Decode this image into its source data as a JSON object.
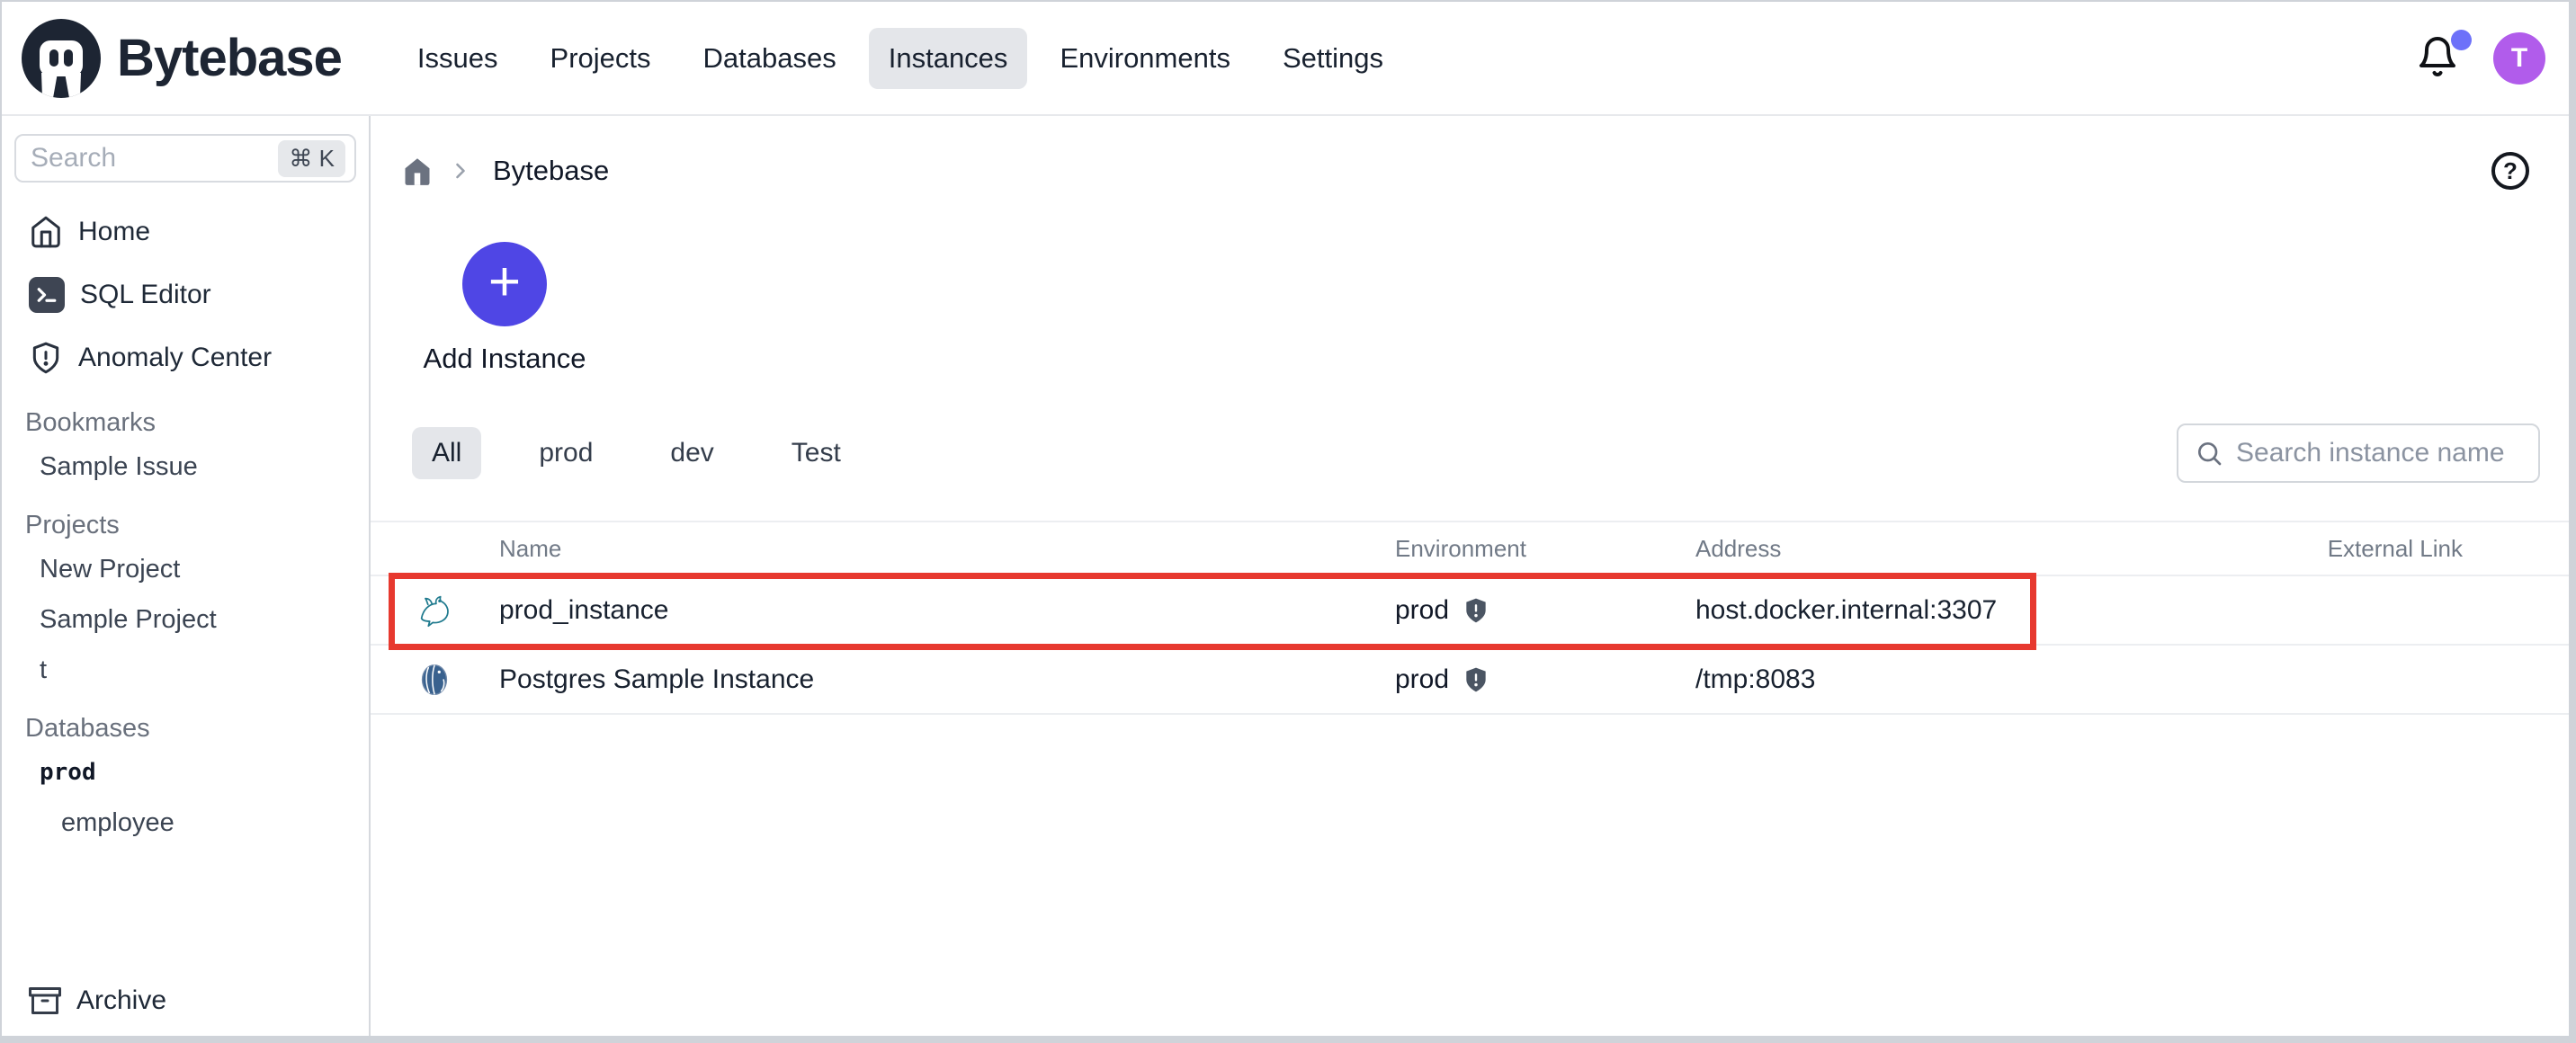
{
  "header": {
    "brand": "Bytebase",
    "nav": [
      {
        "label": "Issues",
        "active": false
      },
      {
        "label": "Projects",
        "active": false
      },
      {
        "label": "Databases",
        "active": false
      },
      {
        "label": "Instances",
        "active": true
      },
      {
        "label": "Environments",
        "active": false
      },
      {
        "label": "Settings",
        "active": false
      }
    ],
    "notifications": {
      "has_unread": true
    },
    "avatar_initial": "T"
  },
  "sidebar": {
    "search": {
      "placeholder": "Search",
      "shortcut": "⌘ K"
    },
    "nav_items": [
      {
        "label": "Home",
        "icon": "home-icon"
      },
      {
        "label": "SQL Editor",
        "icon": "terminal-icon"
      },
      {
        "label": "Anomaly Center",
        "icon": "shield-alert-icon"
      }
    ],
    "sections": [
      {
        "title": "Bookmarks",
        "items": [
          "Sample Issue"
        ]
      },
      {
        "title": "Projects",
        "items": [
          "New Project",
          "Sample Project",
          "t"
        ]
      },
      {
        "title": "Databases",
        "items": [
          "prod",
          "employee"
        ]
      }
    ],
    "archive_label": "Archive"
  },
  "main": {
    "breadcrumb": {
      "current": "Bytebase"
    },
    "add_instance_label": "Add Instance",
    "plus_glyph": "+",
    "help_glyph": "?",
    "filters": [
      {
        "label": "All",
        "active": true
      },
      {
        "label": "prod",
        "active": false
      },
      {
        "label": "dev",
        "active": false
      },
      {
        "label": "Test",
        "active": false
      }
    ],
    "search_placeholder": "Search instance name",
    "table": {
      "columns": [
        "Name",
        "Environment",
        "Address",
        "External Link"
      ],
      "rows": [
        {
          "name": "prod_instance",
          "engine": "mysql",
          "environment": "prod",
          "address": "host.docker.internal:3307",
          "external_link": "",
          "highlighted": true
        },
        {
          "name": "Postgres Sample Instance",
          "engine": "postgres",
          "environment": "prod",
          "address": "/tmp:8083",
          "external_link": "",
          "highlighted": false
        }
      ]
    }
  },
  "colors": {
    "accent_indigo": "#4f46e5",
    "avatar_purple": "#b15ceb",
    "notification_dot": "#6d71f9",
    "highlight_red": "#e7392f",
    "active_pill_bg": "#e4e6ea",
    "mysql_teal": "#1f7a8e",
    "postgres_blue": "#39618e",
    "logo_navy": "#1d2533"
  }
}
